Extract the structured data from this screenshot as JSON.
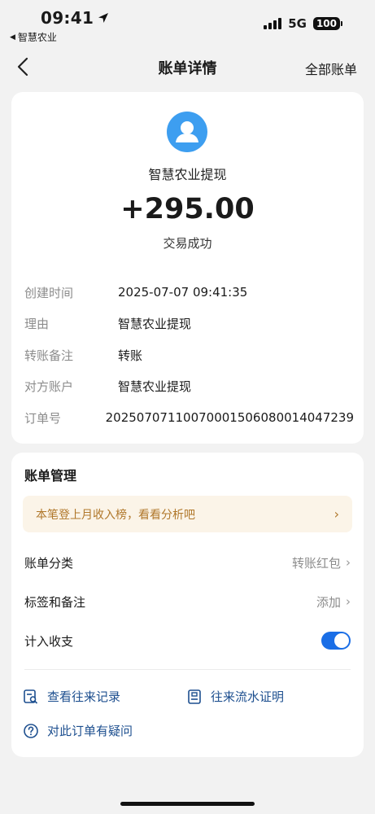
{
  "status_bar": {
    "time": "09:41",
    "back_app": "智慧农业",
    "network": "5G",
    "battery": "100"
  },
  "nav": {
    "title": "账单详情",
    "right_link": "全部账单"
  },
  "summary": {
    "merchant": "智慧农业提现",
    "amount": "+295.00",
    "status": "交易成功"
  },
  "details": [
    {
      "label": "创建时间",
      "value": "2025-07-07 09:41:35"
    },
    {
      "label": "理由",
      "value": "智慧农业提现"
    },
    {
      "label": "转账备注",
      "value": "转账"
    },
    {
      "label": "对方账户",
      "value": "智慧农业提现"
    },
    {
      "label": "订单号",
      "value": "20250707110070001506080014047239"
    }
  ],
  "management": {
    "title": "账单管理",
    "banner": "本笔登上月收入榜，看看分析吧",
    "category_label": "账单分类",
    "category_value": "转账红包",
    "tags_label": "标签和备注",
    "tags_value": "添加",
    "income_label": "计入收支",
    "income_enabled": true
  },
  "links": {
    "history": "查看往来记录",
    "proof": "往来流水证明",
    "question": "对此订单有疑问"
  },
  "colors": {
    "accent": "#1a6ee6",
    "link": "#1d4f8f",
    "avatar": "#3d9ef0",
    "banner_text": "#b0772a",
    "banner_bg": "#fbf4e8"
  }
}
